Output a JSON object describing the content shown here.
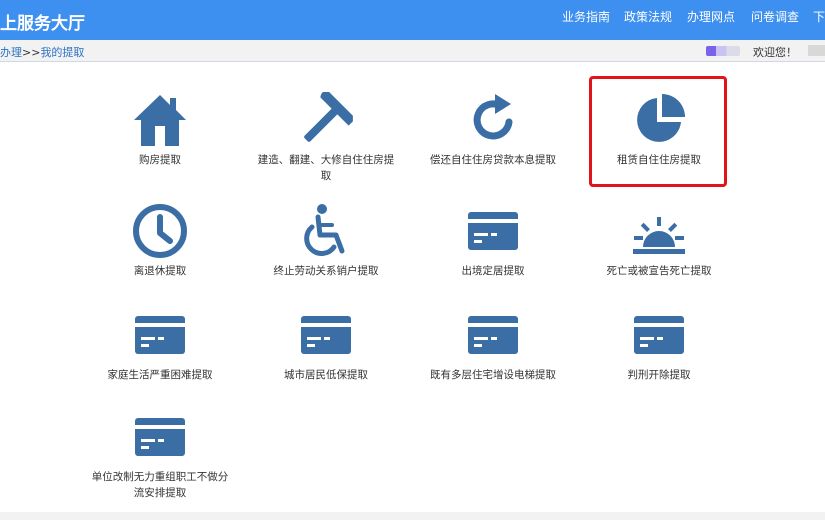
{
  "header": {
    "title": "上服务大厅",
    "nav": [
      "业务指南",
      "政策法规",
      "办理网点",
      "问卷调查",
      "下"
    ]
  },
  "breadcrumb": {
    "prefix": "办理",
    "sep": ">>",
    "current": "我的提取"
  },
  "user": {
    "welcome": "欢迎您！"
  },
  "items": [
    {
      "label": "购房提取",
      "icon": "house-icon"
    },
    {
      "label": "建造、翻建、大修自住住房提取",
      "icon": "hammer-icon"
    },
    {
      "label": "偿还自住住房贷款本息提取",
      "icon": "refresh-icon"
    },
    {
      "label": "租赁自住住房提取",
      "icon": "pie-chart-icon"
    },
    {
      "label": "离退休提取",
      "icon": "clock-icon"
    },
    {
      "label": "终止劳动关系销户提取",
      "icon": "wheelchair-icon"
    },
    {
      "label": "出境定居提取",
      "icon": "card-icon"
    },
    {
      "label": "死亡或被宣告死亡提取",
      "icon": "sunrise-icon"
    },
    {
      "label": "家庭生活严重困难提取",
      "icon": "card-icon"
    },
    {
      "label": "城市居民低保提取",
      "icon": "card-icon"
    },
    {
      "label": "既有多层住宅增设电梯提取",
      "icon": "card-icon"
    },
    {
      "label": "判刑开除提取",
      "icon": "card-icon"
    },
    {
      "label": "单位改制无力重组职工不做分流安排提取",
      "icon": "card-icon"
    }
  ],
  "colors": {
    "accent": "#3d8ff0",
    "icon": "#3a6ea5",
    "highlight": "#e1141c"
  }
}
